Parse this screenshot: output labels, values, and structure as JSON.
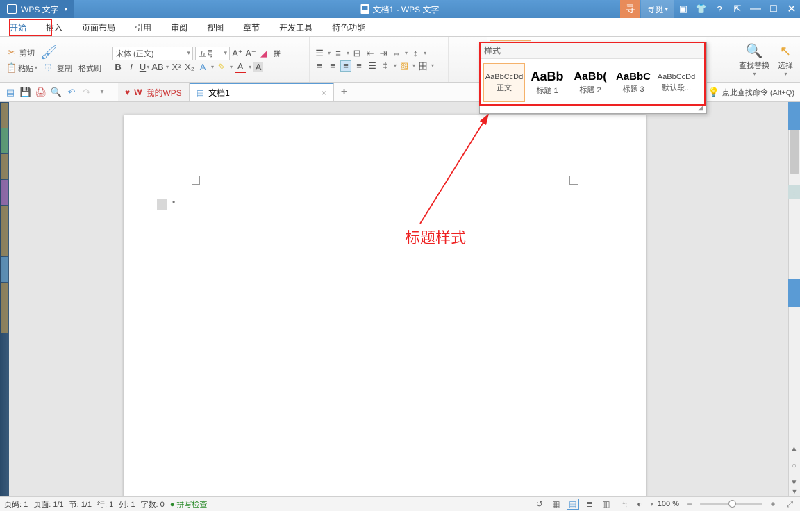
{
  "title": {
    "app": "WPS 文字",
    "doc": "文档1 - WPS 文字",
    "search_label": "寻觅"
  },
  "tabs": [
    "开始",
    "插入",
    "页面布局",
    "引用",
    "审阅",
    "视图",
    "章节",
    "开发工具",
    "特色功能"
  ],
  "active_tab": 0,
  "clipboard": {
    "cut": "剪切",
    "copy": "复制",
    "paste": "粘贴",
    "fmt": "格式刷"
  },
  "font": {
    "family": "宋体 (正文)",
    "size": "五号"
  },
  "styles_header": "样式",
  "styles": [
    {
      "preview": "AaBbCcDd",
      "label": "正文",
      "cls": "",
      "selected": true
    },
    {
      "preview": "AaBb",
      "label": "标题 1",
      "cls": "h1"
    },
    {
      "preview": "AaBb(",
      "label": "标题 2",
      "cls": "h2"
    },
    {
      "preview": "AaBbC",
      "label": "标题 3",
      "cls": "h3"
    },
    {
      "preview": "AaBbCcDd",
      "label": "默认段...",
      "cls": ""
    }
  ],
  "right_tools": {
    "find": "查找替换",
    "select": "选择"
  },
  "qat_tip": "点此查找命令 (Alt+Q)",
  "doc_tabs": {
    "home": "我的WPS",
    "doc": "文档1"
  },
  "status": {
    "page_num": "页码: 1",
    "page": "页面: 1/1",
    "section": "节: 1/1",
    "line": "行: 1",
    "col": "列: 1",
    "words": "字数: 0",
    "spell": "拼写检查",
    "zoom": "100 %"
  },
  "annotation": "标题样式"
}
